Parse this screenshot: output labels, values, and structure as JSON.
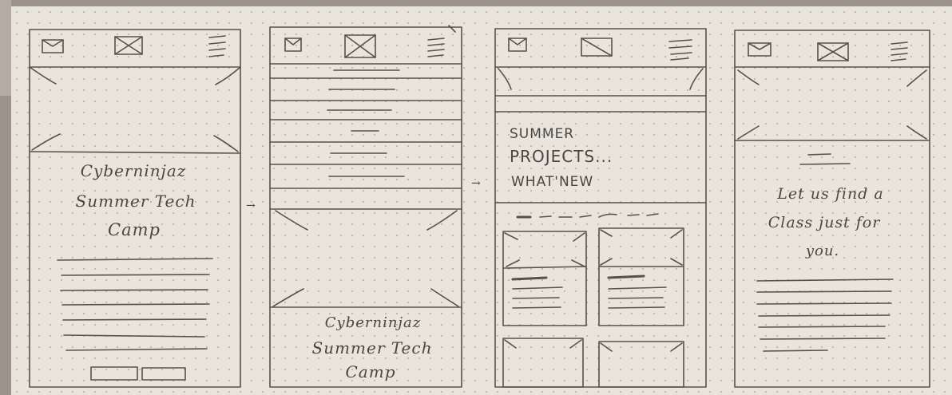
{
  "panel1": {
    "title_lines": [
      "Cyberninjaz",
      "Summer Tech",
      "Camp"
    ]
  },
  "panel2": {
    "title_lines": [
      "Cyberninjaz",
      "Summer Tech",
      "Camp"
    ]
  },
  "panel3": {
    "heading_lines": [
      "SUMMER",
      "PROJECTS...",
      "WHAT'NEW"
    ]
  },
  "panel4": {
    "text_lines": [
      "Let us find a",
      "Class just for",
      "you."
    ]
  },
  "arrows": [
    "→",
    "→"
  ]
}
